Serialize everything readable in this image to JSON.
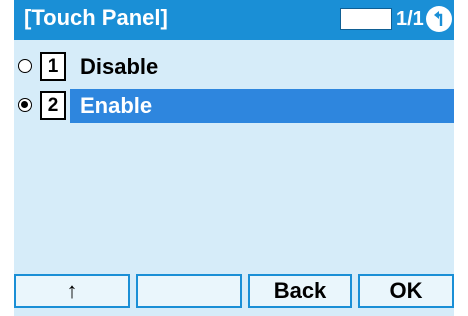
{
  "header": {
    "title": "[Touch Panel]",
    "page_indicator": "1/1",
    "nav_icon": "return-arrow-icon"
  },
  "options": [
    {
      "number": "1",
      "label": "Disable",
      "selected": false
    },
    {
      "number": "2",
      "label": "Enable",
      "selected": true
    }
  ],
  "softkeys": [
    {
      "label": "↑"
    },
    {
      "label": ""
    },
    {
      "label": "Back"
    },
    {
      "label": "OK"
    }
  ],
  "colors": {
    "header": "#1a8fd6",
    "background": "#d6ecf9",
    "selection": "#2e86de"
  }
}
